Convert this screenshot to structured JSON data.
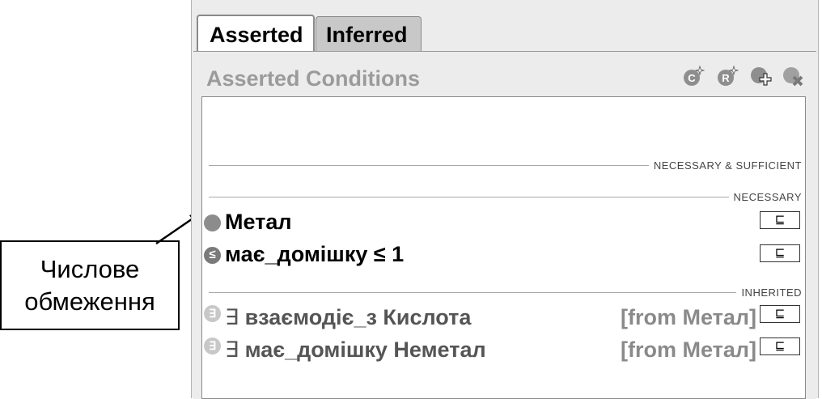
{
  "tabs": {
    "asserted": "Asserted",
    "inferred": "Inferred"
  },
  "header": {
    "title": "Asserted Conditions",
    "icons": [
      "add-named-class-icon",
      "add-restriction-icon",
      "create-class-icon",
      "delete-class-icon"
    ]
  },
  "sections": {
    "necessary_sufficient": "NECESSARY & SUFFICIENT",
    "necessary": "NECESSARY",
    "inherited": "INHERITED"
  },
  "necessary_rows": [
    {
      "bullet": "",
      "text": "Метал",
      "button": "⊑"
    },
    {
      "bullet": "≤",
      "text": "має_домішку ≤ 1",
      "button": "⊑"
    }
  ],
  "inherited_rows": [
    {
      "bullet": "∃",
      "quantifier": "∃",
      "text": "взаємодіє_з Кислота",
      "from": "[from Метал]",
      "button": "⊑"
    },
    {
      "bullet": "∃",
      "quantifier": "∃",
      "text": "має_домішку Неметал",
      "from": "[from Метал]",
      "button": "⊑"
    }
  ],
  "callout": {
    "line1": "Числове",
    "line2": "обмеження"
  },
  "colors": {
    "panel": "#ececec",
    "tab_inactive": "#c8c8c8",
    "header_text": "#9b9b9b"
  }
}
